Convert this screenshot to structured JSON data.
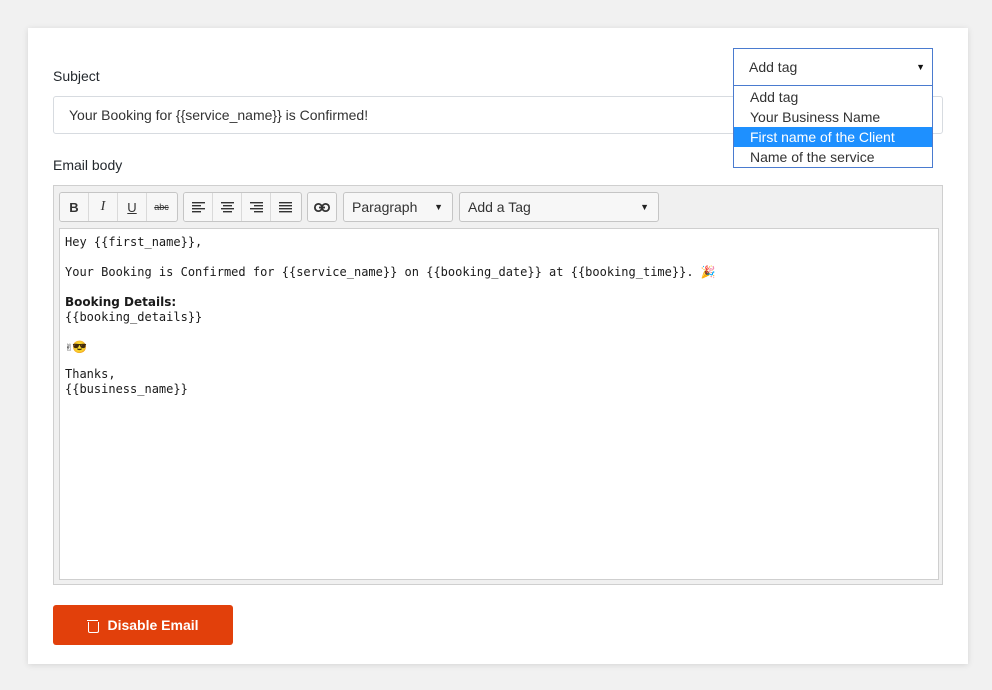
{
  "subject": {
    "label": "Subject",
    "value": "Your Booking for {{service_name}} is Confirmed!"
  },
  "email_body": {
    "label": "Email body"
  },
  "toolbar": {
    "bold": "B",
    "italic": "I",
    "underline": "U",
    "strike": "abc",
    "paragraph": "Paragraph",
    "add_a_tag": "Add a Tag"
  },
  "content": {
    "line1": "Hey {{first_name}},",
    "line2": "Your Booking is Confirmed for {{service_name}} on {{booking_date}} at {{booking_time}}. 🎉",
    "details_title": "Booking Details:",
    "details_value": "{{booking_details}}",
    "emoji_line": "✌😎",
    "thanks": "Thanks,",
    "signature": "{{business_name}}"
  },
  "disable_button": {
    "label": "Disable Email"
  },
  "tag_dropdown": {
    "selected": "Add tag",
    "options": [
      "Add tag",
      "Your Business Name",
      "First name of the Client",
      "Name of the service"
    ],
    "highlighted_index": 2
  },
  "colors": {
    "accent_button": "#e2400b",
    "dropdown_border": "#4a7bcf",
    "highlight": "#1e90ff"
  }
}
